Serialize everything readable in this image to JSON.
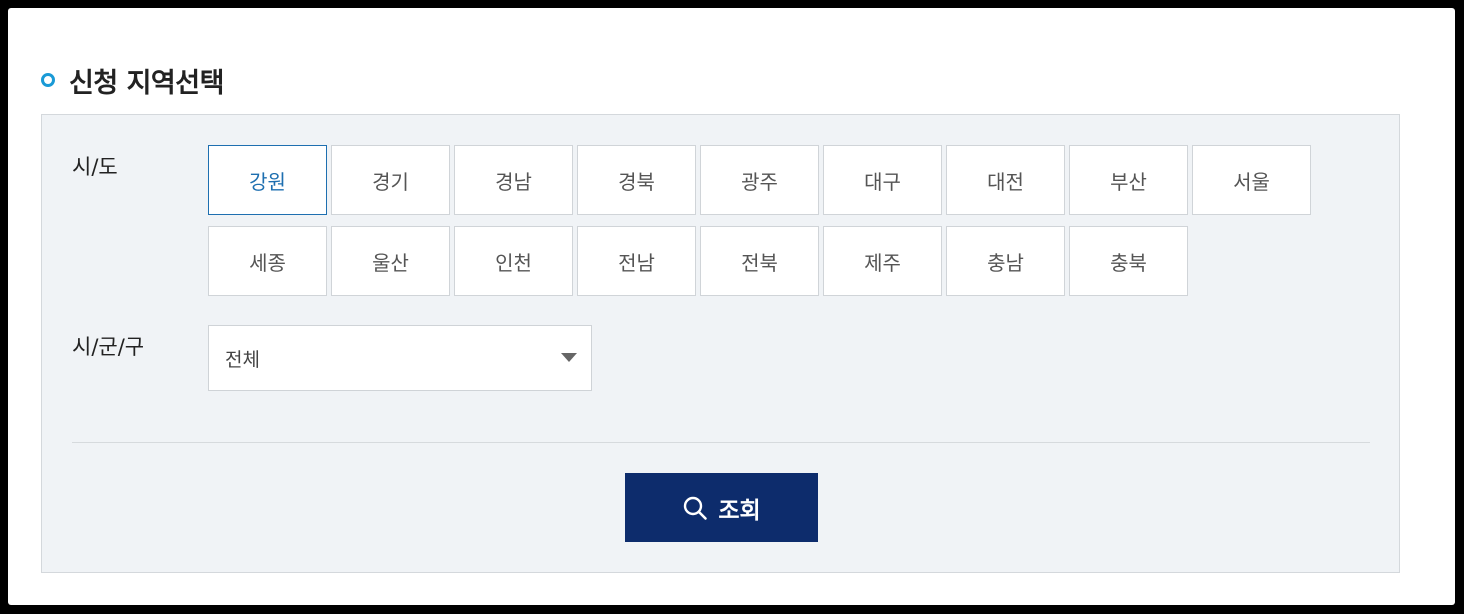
{
  "section": {
    "title": "신청 지역선택",
    "accent_color": "#1a9ad6"
  },
  "filters": {
    "sido_label": "시/도",
    "sigungu_label": "시/군/구",
    "selected_region": "강원",
    "regions": [
      "강원",
      "경기",
      "경남",
      "경북",
      "광주",
      "대구",
      "대전",
      "부산",
      "서울",
      "세종",
      "울산",
      "인천",
      "전남",
      "전북",
      "제주",
      "충남",
      "충북"
    ],
    "sigungu_selected": "전체",
    "select_icon": "chevron-down-icon"
  },
  "actions": {
    "search_label": "조회",
    "search_icon": "search-icon",
    "button_color": "#0d2c6c"
  }
}
